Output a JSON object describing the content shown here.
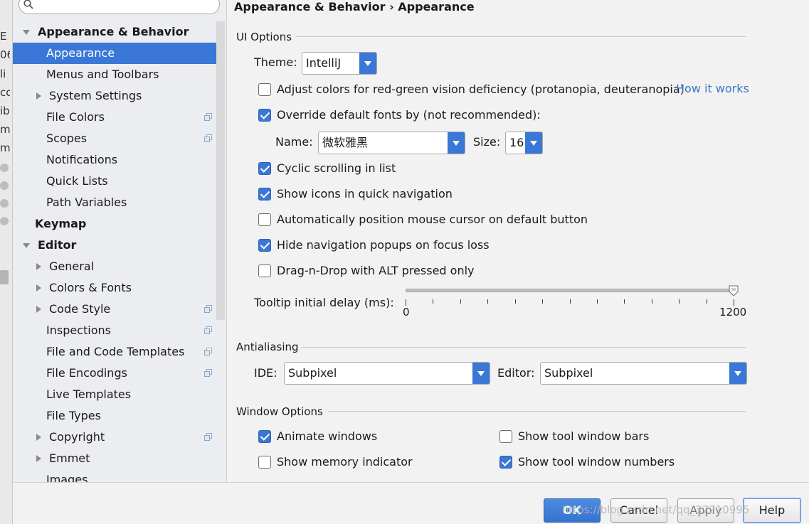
{
  "background_window": {
    "fragments": [
      "E",
      "06",
      "li",
      "co",
      "ib",
      "m",
      "m"
    ]
  },
  "sidebar": {
    "search": {
      "placeholder": "",
      "value": ""
    },
    "items": [
      {
        "label": "Appearance & Behavior",
        "level": 0,
        "bold": true,
        "arrow": "down"
      },
      {
        "label": "Appearance",
        "level": 1,
        "selected": true
      },
      {
        "label": "Menus and Toolbars",
        "level": 1
      },
      {
        "label": "System Settings",
        "level": 1,
        "arrow": "right"
      },
      {
        "label": "File Colors",
        "level": 1,
        "copy_icon": true
      },
      {
        "label": "Scopes",
        "level": 1,
        "copy_icon": true
      },
      {
        "label": "Notifications",
        "level": 1
      },
      {
        "label": "Quick Lists",
        "level": 1
      },
      {
        "label": "Path Variables",
        "level": 1
      },
      {
        "label": "Keymap",
        "level": 0,
        "bold": true
      },
      {
        "label": "Editor",
        "level": 0,
        "bold": true,
        "arrow": "down"
      },
      {
        "label": "General",
        "level": 1,
        "arrow": "right"
      },
      {
        "label": "Colors & Fonts",
        "level": 1,
        "arrow": "right"
      },
      {
        "label": "Code Style",
        "level": 1,
        "arrow": "right",
        "copy_icon": true
      },
      {
        "label": "Inspections",
        "level": 1,
        "copy_icon": true
      },
      {
        "label": "File and Code Templates",
        "level": 1,
        "copy_icon": true
      },
      {
        "label": "File Encodings",
        "level": 1,
        "copy_icon": true
      },
      {
        "label": "Live Templates",
        "level": 1
      },
      {
        "label": "File Types",
        "level": 1
      },
      {
        "label": "Copyright",
        "level": 1,
        "arrow": "right",
        "copy_icon": true
      },
      {
        "label": "Emmet",
        "level": 1,
        "arrow": "right"
      },
      {
        "label": "Images",
        "level": 1
      }
    ]
  },
  "header": {
    "breadcrumb_parent": "Appearance & Behavior",
    "breadcrumb_sep": "›",
    "breadcrumb_current": "Appearance"
  },
  "ui_options": {
    "title": "UI Options",
    "theme_label": "Theme:",
    "theme_value": "IntelliJ",
    "color_deficiency": {
      "label": "Adjust colors for red-green vision deficiency (protanopia, deuteranopia)",
      "checked": false
    },
    "how_it_works": "How it works",
    "override_fonts": {
      "label": "Override default fonts by (not recommended):",
      "checked": true
    },
    "name_label": "Name:",
    "name_value": "微软雅黑",
    "size_label": "Size:",
    "size_value": "16",
    "cyclic_scrolling": {
      "label": "Cyclic scrolling in list",
      "checked": true
    },
    "show_icons": {
      "label": "Show icons in quick navigation",
      "checked": true
    },
    "auto_mouse": {
      "label": "Automatically position mouse cursor on default button",
      "checked": false
    },
    "hide_popups": {
      "label": "Hide navigation popups on focus loss",
      "checked": true
    },
    "drag_drop": {
      "label": "Drag-n-Drop with ALT pressed only",
      "checked": false
    },
    "tooltip_label": "Tooltip initial delay (ms):",
    "tooltip_min": "0",
    "tooltip_max": "1200",
    "tooltip_value": 1200
  },
  "antialiasing": {
    "title": "Antialiasing",
    "ide_label": "IDE:",
    "ide_value": "Subpixel",
    "editor_label": "Editor:",
    "editor_value": "Subpixel"
  },
  "window_options": {
    "title": "Window Options",
    "animate_windows": {
      "label": "Animate windows",
      "checked": true
    },
    "show_memory": {
      "label": "Show memory indicator",
      "checked": false
    },
    "show_tool_bars": {
      "label": "Show tool window bars",
      "checked": false
    },
    "show_tool_numbers": {
      "label": "Show tool window numbers",
      "checked": true
    }
  },
  "buttons": {
    "ok": "OK",
    "cancel": "Cancel",
    "apply": "Apply",
    "help": "Help"
  },
  "watermark": "https://blog.csdn.net/qq_37210995",
  "colors": {
    "accent": "#3a77d6",
    "link": "#3a77c5",
    "sidebar_bg": "#ecedf1",
    "panel_bg": "#f2f2f2"
  }
}
